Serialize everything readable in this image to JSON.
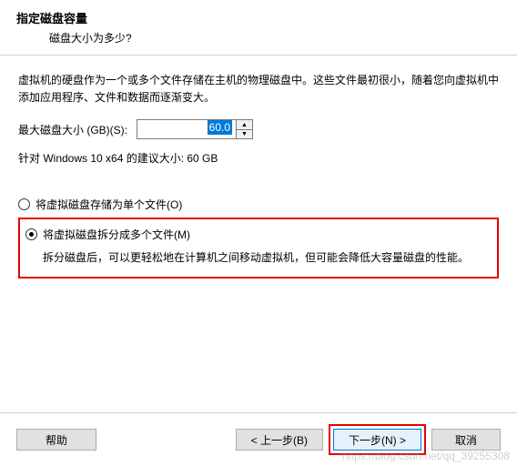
{
  "header": {
    "title": "指定磁盘容量",
    "subtitle": "磁盘大小为多少?"
  },
  "main": {
    "description": "虚拟机的硬盘作为一个或多个文件存储在主机的物理磁盘中。这些文件最初很小，随着您向虚拟机中添加应用程序、文件和数据而逐渐变大。",
    "size_label": "最大磁盘大小 (GB)(S):",
    "size_value": "60.0",
    "recommendation": "针对 Windows 10 x64 的建议大小: 60 GB",
    "option_single": "将虚拟磁盘存储为单个文件(O)",
    "option_split": "将虚拟磁盘拆分成多个文件(M)",
    "split_desc": "拆分磁盘后，可以更轻松地在计算机之间移动虚拟机，但可能会降低大容量磁盘的性能。"
  },
  "footer": {
    "help": "帮助",
    "back": "< 上一步(B)",
    "next": "下一步(N) >",
    "cancel": "取消"
  },
  "watermark": "https://blog.csdn.net/qq_39255308"
}
